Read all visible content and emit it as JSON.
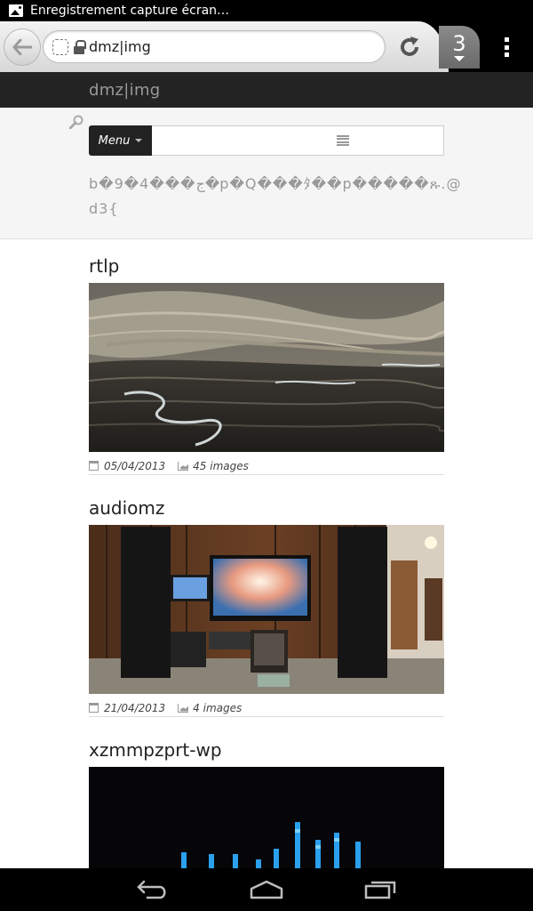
{
  "status_bar": {
    "notification": "Enregistrement capture écran…"
  },
  "browser": {
    "url": "dmz|img",
    "tab_count": "3"
  },
  "site": {
    "title": "dmz|img"
  },
  "search": {
    "menu_label": "Menu",
    "placeholder": "",
    "garbled_text": "b�9�4���ج�p�Q���ﾀ��p�����ጹ.@d3{"
  },
  "galleries": [
    {
      "title": "rtlp",
      "date": "05/04/2013",
      "count": "45 images",
      "image": "rocky-riverbed-landscape"
    },
    {
      "title": "audiomz",
      "date": "21/04/2013",
      "count": "4 images",
      "image": "basement-audio-room-panorama"
    },
    {
      "title": "xzmmpzprt-wp",
      "image": "blue-equalizer-bars-dark"
    }
  ],
  "icons": [
    "back-arrow-icon",
    "page-icon",
    "lock-icon",
    "reload-icon",
    "overflow-menu-icon",
    "search-icon",
    "list-icon",
    "calendar-icon",
    "chart-icon",
    "nav-back-icon",
    "nav-home-icon",
    "nav-recents-icon"
  ]
}
